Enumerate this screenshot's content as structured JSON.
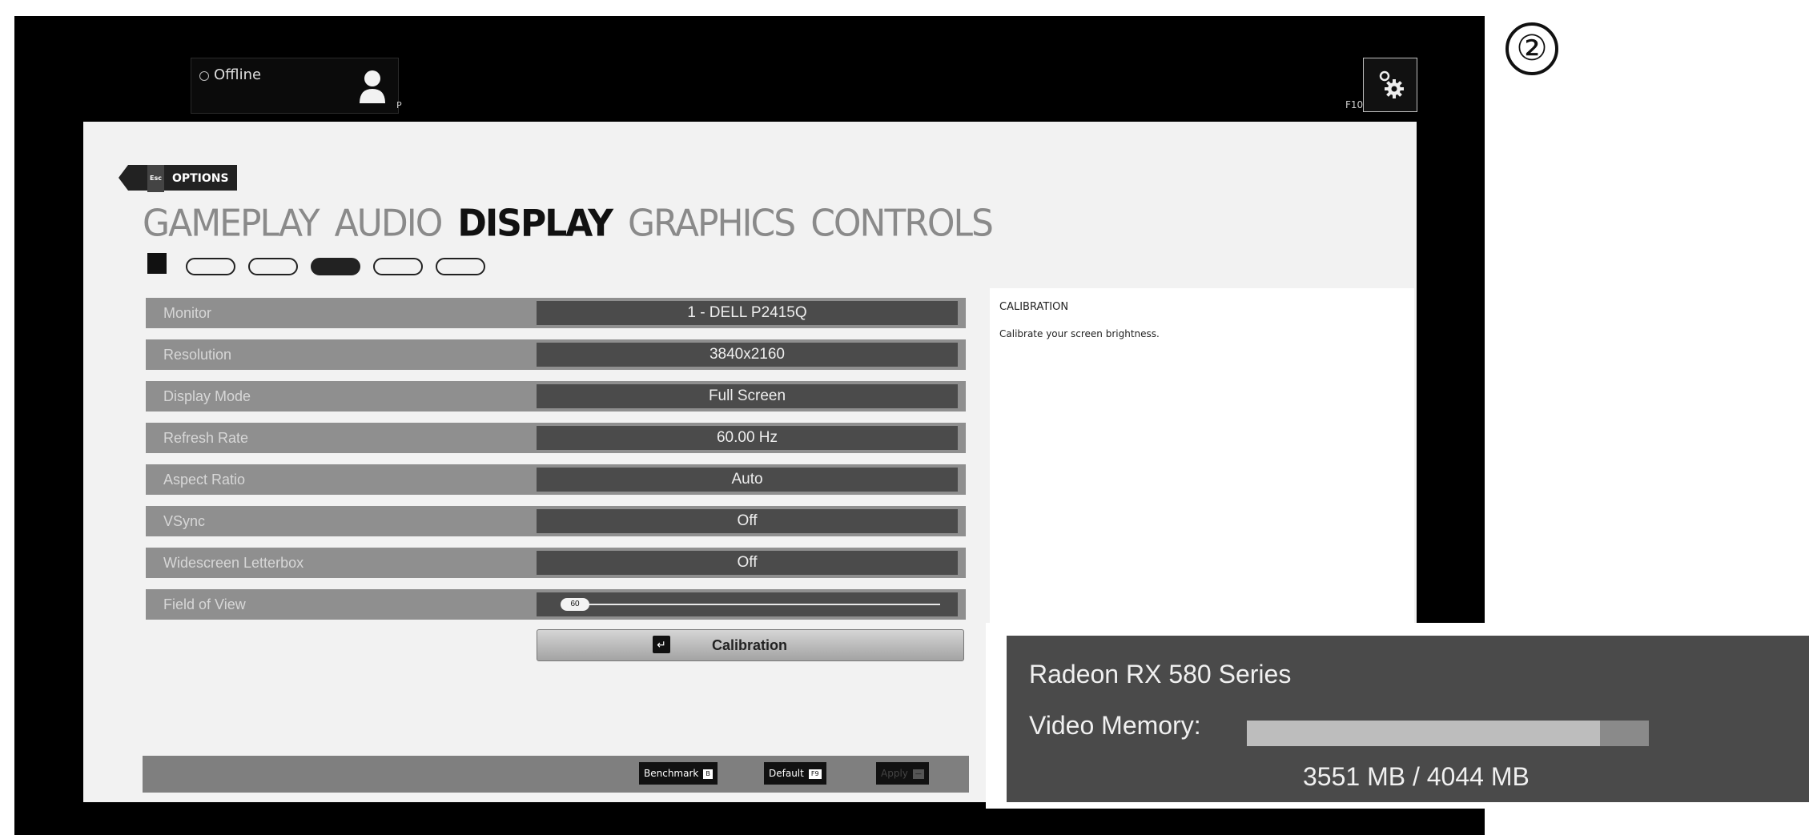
{
  "step_marker": "②",
  "account": {
    "status": "Offline",
    "hotkey": "P"
  },
  "settings_hotkey": "F10",
  "breadcrumb": {
    "key": "Esc",
    "label": "OPTIONS"
  },
  "tabs": [
    {
      "label": "GAMEPLAY",
      "active": false
    },
    {
      "label": "AUDIO",
      "active": false
    },
    {
      "label": "DISPLAY",
      "active": true
    },
    {
      "label": "GRAPHICS",
      "active": false
    },
    {
      "label": "CONTROLS",
      "active": false
    }
  ],
  "page_indicator": {
    "count": 5,
    "current": 3
  },
  "settings": [
    {
      "label": "Monitor",
      "value": "1 - DELL P2415Q"
    },
    {
      "label": "Resolution",
      "value": "3840x2160"
    },
    {
      "label": "Display Mode",
      "value": "Full Screen"
    },
    {
      "label": "Refresh Rate",
      "value": "60.00 Hz"
    },
    {
      "label": "Aspect Ratio",
      "value": "Auto"
    },
    {
      "label": "VSync",
      "value": "Off"
    },
    {
      "label": "Widescreen Letterbox",
      "value": "Off"
    }
  ],
  "fov": {
    "label": "Field of View",
    "value": "60"
  },
  "calibration_button": "Calibration",
  "info": {
    "title": "CALIBRATION",
    "description": "Calibrate your screen brightness."
  },
  "footer": {
    "benchmark": {
      "label": "Benchmark",
      "key": "B"
    },
    "default": {
      "label": "Default",
      "key": "F9"
    },
    "apply": {
      "label": "Apply",
      "key": "—"
    }
  },
  "gpu": {
    "name": "Radeon RX 580 Series",
    "memory_label": "Video Memory:",
    "memory_text": "3551 MB / 4044 MB",
    "used_mb": 3551,
    "total_mb": 4044
  }
}
